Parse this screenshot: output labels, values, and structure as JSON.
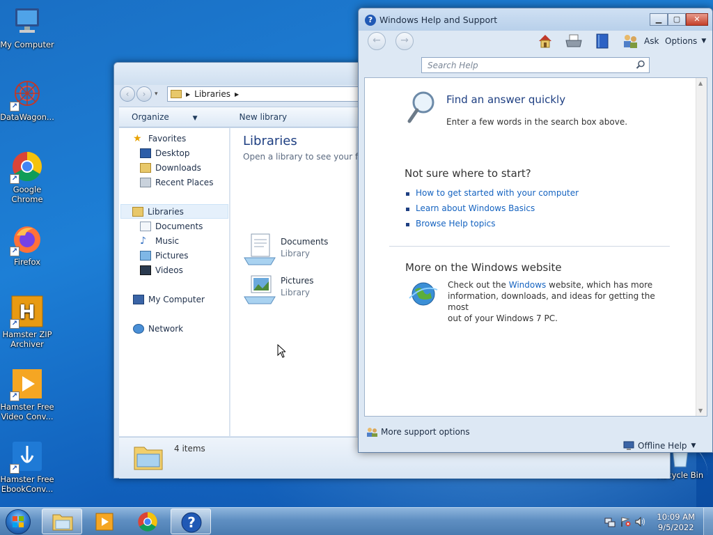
{
  "desktop": {
    "icons": [
      {
        "label": "My Computer"
      },
      {
        "label": "DataWagon..."
      },
      {
        "label": "Google Chrome"
      },
      {
        "label": "Firefox"
      },
      {
        "label": "Hamster ZIP Archiver"
      },
      {
        "label": "Hamster Free Video Conv..."
      },
      {
        "label": "Hamster Free EbookConv..."
      },
      {
        "label": "Recycle Bin"
      }
    ]
  },
  "explorer": {
    "breadcrumb": "Libraries",
    "toolbar": {
      "organize": "Organize",
      "new_library": "New library"
    },
    "nav": {
      "favorites": "Favorites",
      "desktop": "Desktop",
      "downloads": "Downloads",
      "recent_places": "Recent Places",
      "libraries": "Libraries",
      "documents": "Documents",
      "music": "Music",
      "pictures": "Pictures",
      "videos": "Videos",
      "my_computer": "My Computer",
      "network": "Network"
    },
    "content": {
      "title": "Libraries",
      "subtitle": "Open a library to see your files a",
      "items": [
        {
          "name": "Documents",
          "type": "Library"
        },
        {
          "name": "Pictures",
          "type": "Library"
        }
      ]
    },
    "status": {
      "count": "4 items"
    }
  },
  "help": {
    "title": "Windows Help and Support",
    "toolbar": {
      "ask": "Ask",
      "options": "Options"
    },
    "search_placeholder": "Search Help",
    "find_heading": "Find an answer quickly",
    "find_text": "Enter a few words in the search box above.",
    "start_heading": "Not sure where to start?",
    "links": [
      "How to get started with your computer",
      "Learn about Windows Basics",
      "Browse Help topics"
    ],
    "web_heading": "More on the Windows website",
    "web_text_pre": "Check out the",
    "web_link": "Windows",
    "web_text_line1": "website, which has more",
    "web_text_line2": "information, downloads, and ideas for getting the most",
    "web_text_line3": "out of your Windows 7 PC.",
    "more_support": "More support options",
    "offline_help": "Offline Help"
  },
  "taskbar": {
    "clock_time": "10:09 AM",
    "clock_date": "9/5/2022"
  }
}
